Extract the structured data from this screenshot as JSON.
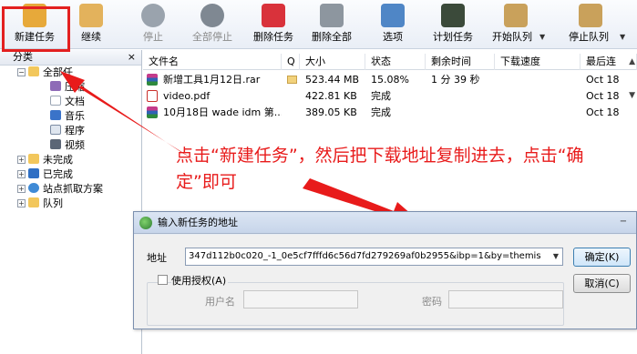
{
  "toolbar": {
    "buttons": [
      {
        "label": "新建任务",
        "icon": "new-task-icon",
        "color": "#e7a93a"
      },
      {
        "label": "继续",
        "icon": "resume-icon",
        "color": "#e3b25c"
      },
      {
        "label": "停止",
        "icon": "stop-icon",
        "color": "#9aa3ad"
      },
      {
        "label": "全部停止",
        "icon": "stop-all-icon",
        "color": "#9aa3ad"
      },
      {
        "label": "删除任务",
        "icon": "delete-icon",
        "color": "#d9323b"
      },
      {
        "label": "删除全部",
        "icon": "trash-icon",
        "color": "#8d969f"
      },
      {
        "label": "选项",
        "icon": "tools-icon",
        "color": "#4f86c6"
      },
      {
        "label": "计划任务",
        "icon": "schedule-icon",
        "color": "#3b4a3a"
      },
      {
        "label": "开始队列",
        "icon": "start-queue-icon",
        "color": "#c9a15b"
      },
      {
        "label": "停止队列",
        "icon": "stop-queue-icon",
        "color": "#c9a15b"
      }
    ]
  },
  "sidebar": {
    "header": "分类",
    "close_glyph": "×",
    "items": [
      {
        "label": "全部任",
        "icon": "folder-open-icon"
      },
      {
        "label": "压缩",
        "icon": "archive-icon"
      },
      {
        "label": "文档",
        "icon": "document-icon"
      },
      {
        "label": "音乐",
        "icon": "music-icon"
      },
      {
        "label": "程序",
        "icon": "program-icon"
      },
      {
        "label": "视频",
        "icon": "video-icon"
      },
      {
        "label": "未完成",
        "icon": "incomplete-folder-icon"
      },
      {
        "label": "已完成",
        "icon": "complete-folder-icon"
      },
      {
        "label": "站点抓取方案",
        "icon": "site-grabber-icon"
      },
      {
        "label": "队列",
        "icon": "queue-folder-icon"
      }
    ]
  },
  "list": {
    "columns": [
      "文件名",
      "Q",
      "大小",
      "状态",
      "剩余时间",
      "下载速度",
      "最后连"
    ],
    "rows": [
      {
        "name": "新增工具1月12日.rar",
        "q": "",
        "size": "523.44 MB",
        "status": "15.08%",
        "remaining": "1 分 39 秒",
        "speed": "",
        "last": "Oct 18",
        "icon": "rar-icon"
      },
      {
        "name": "video.pdf",
        "q": "",
        "size": "422.81 KB",
        "status": "完成",
        "remaining": "",
        "speed": "",
        "last": "Oct 18",
        "icon": "pdf-icon"
      },
      {
        "name": "10月18日 wade idm 第...",
        "q": "",
        "size": "389.05 KB",
        "status": "完成",
        "remaining": "",
        "speed": "",
        "last": "Oct 18",
        "icon": "rar-icon"
      }
    ]
  },
  "annotation": {
    "text": "点击“新建任务”，然后把下载地址复制进去，点击“确定”即可",
    "color": "#e81b1b"
  },
  "dialog": {
    "title": "输入新任务的地址",
    "address_label": "地址",
    "address_value": "347d112b0c020_-1_0e5cf7fffd6c56d7fd279269af0b2955&ibp=1&by=themis",
    "ok_label": "确定(K)",
    "cancel_label": "取消(C)",
    "auth_label": "使用授权(A)",
    "username_label": "用户名",
    "password_label": "密码"
  }
}
